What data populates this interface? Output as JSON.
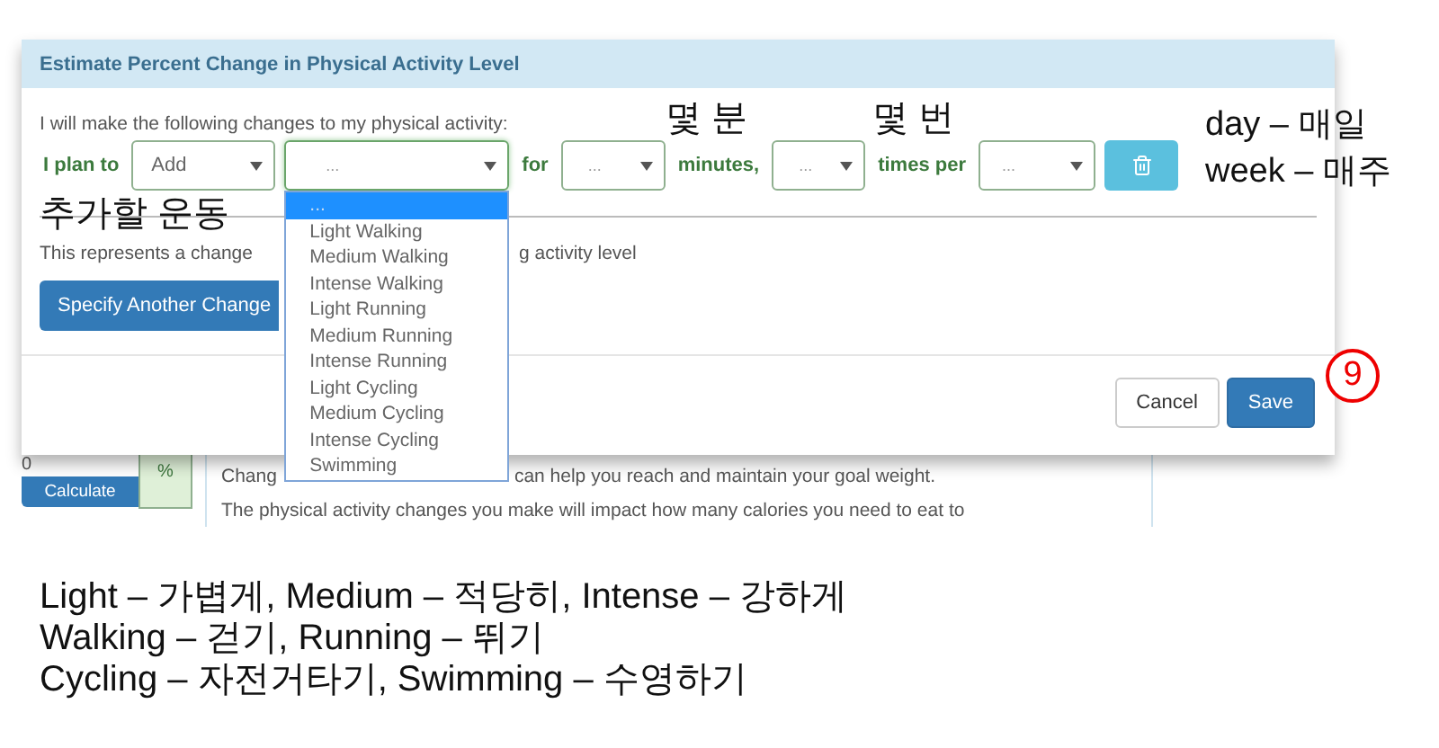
{
  "dialog": {
    "title": "Estimate Percent Change in Physical Activity Level",
    "intro": "I will make the following changes to my physical activity:",
    "plan_row": {
      "lead": "I plan to",
      "action": {
        "value": "Add"
      },
      "activity": {
        "placeholder": "...",
        "expanded": true,
        "options": [
          {
            "label": "...",
            "selected": true
          },
          {
            "label": "Light Walking",
            "selected": false
          },
          {
            "label": "Medium Walking",
            "selected": false
          },
          {
            "label": "Intense Walking",
            "selected": false
          },
          {
            "label": "Light Running",
            "selected": false
          },
          {
            "label": "Medium Running",
            "selected": false
          },
          {
            "label": "Intense Running",
            "selected": false
          },
          {
            "label": "Light Cycling",
            "selected": false
          },
          {
            "label": "Medium Cycling",
            "selected": false
          },
          {
            "label": "Intense Cycling",
            "selected": false
          },
          {
            "label": "Swimming",
            "selected": false
          }
        ]
      },
      "for_label": "for",
      "minutes": {
        "placeholder": "..."
      },
      "minutes_label": "minutes,",
      "times": {
        "placeholder": "..."
      },
      "times_label": "times per",
      "period": {
        "placeholder": "..."
      }
    },
    "summary_parts": [
      "This represents a change",
      "g activity level"
    ],
    "add_button": "Specify Another Change",
    "buttons": [
      {
        "label": "Cancel",
        "kind": "default"
      },
      {
        "label": "Save",
        "kind": "primary"
      }
    ]
  },
  "background": {
    "value": "0",
    "calculate": "Calculate",
    "unit": "%",
    "text_parts": [
      "Chang",
      "can help you reach and maintain your goal weight."
    ],
    "line_2": "The physical activity changes you make will impact how many calories you need to eat to"
  },
  "annotations": {
    "step": "9",
    "activity_note": "추가할 운동",
    "minutes_note": "몇 분",
    "times_note": "몇 번",
    "period_notes": [
      "day – 매일",
      "week – 매주"
    ],
    "legend": [
      "Light – 가볍게, Medium – 적당히, Intense – 강하게",
      "Walking – 걷기, Running – 뛰기",
      "Cycling – 자전거타기, Swimming – 수영하기"
    ]
  }
}
